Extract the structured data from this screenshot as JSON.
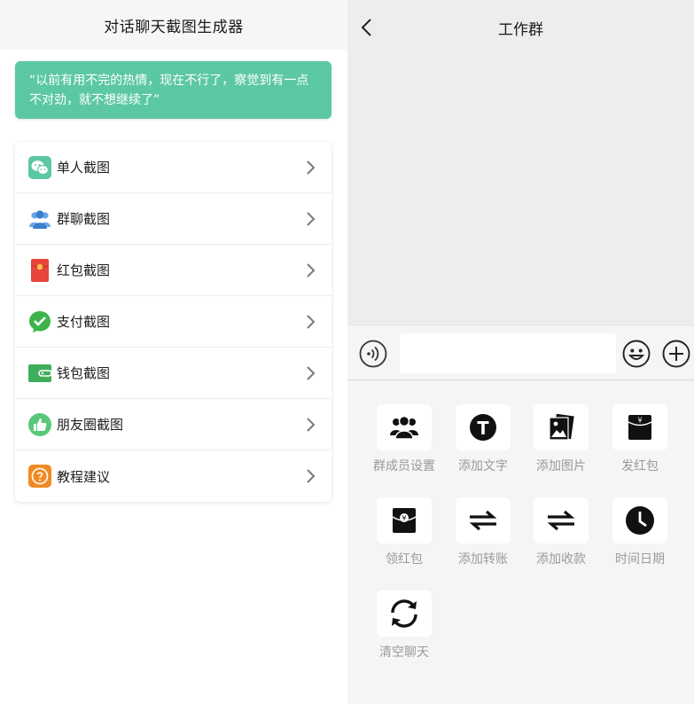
{
  "left": {
    "title": "对话聊天截图生成器",
    "quote": "“以前有用不完的热情，现在不行了，察觉到有一点不对劲，就不想继续了”",
    "menu": [
      {
        "label": "单人截图",
        "icon": "wechat-icon",
        "color": "#5cc8a3"
      },
      {
        "label": "群聊截图",
        "icon": "group-users-icon",
        "color": "#4a90d9"
      },
      {
        "label": "红包截图",
        "icon": "red-packet-icon",
        "color": "#e8453c"
      },
      {
        "label": "支付截图",
        "icon": "payment-check-icon",
        "color": "#3cb44b"
      },
      {
        "label": "钱包截图",
        "icon": "wallet-icon",
        "color": "#3fae5b"
      },
      {
        "label": "朋友圈截图",
        "icon": "thumbs-up-icon",
        "color": "#5ac87a"
      },
      {
        "label": "教程建议",
        "icon": "help-icon",
        "color": "#f08a24"
      }
    ]
  },
  "right": {
    "title": "工作群",
    "input": {
      "value": "",
      "placeholder": ""
    },
    "tools": [
      {
        "label": "群成员设置",
        "icon": "group-members-icon"
      },
      {
        "label": "添加文字",
        "icon": "text-icon"
      },
      {
        "label": "添加图片",
        "icon": "image-icon"
      },
      {
        "label": "发红包",
        "icon": "send-red-packet-icon"
      },
      {
        "label": "领红包",
        "icon": "receive-red-packet-icon"
      },
      {
        "label": "添加转账",
        "icon": "transfer-icon"
      },
      {
        "label": "添加收款",
        "icon": "receive-money-icon"
      },
      {
        "label": "时间日期",
        "icon": "clock-icon"
      },
      {
        "label": "清空聊天",
        "icon": "refresh-icon"
      }
    ]
  },
  "colors": {
    "accent": "#5cc8a3",
    "tool_label": "#9a9a9a",
    "panel_bg": "#ededed"
  }
}
